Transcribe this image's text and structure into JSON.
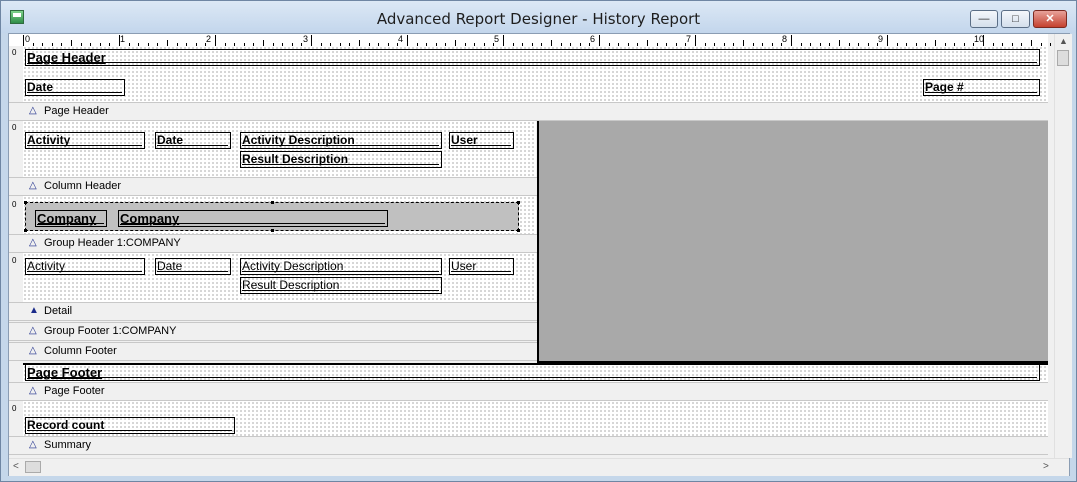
{
  "window": {
    "title": "Advanced Report Designer - History Report",
    "minimize_glyph": "—",
    "maximize_glyph": "□",
    "close_glyph": "✕"
  },
  "ruler": {
    "numbers": [
      "0",
      "1",
      "2",
      "3",
      "4",
      "5",
      "6",
      "7",
      "8",
      "9",
      "10"
    ]
  },
  "band_marker": "0",
  "bands": {
    "page_header": {
      "label": "Page Header",
      "fields": {
        "title": "Page Header",
        "date": "Date",
        "page": "Page #"
      }
    },
    "column_header": {
      "label": "Column Header",
      "fields": {
        "activity": "Activity",
        "date": "Date",
        "activity_description": "Activity Description",
        "user": "User",
        "result_description": "Result Description"
      }
    },
    "group_header": {
      "label": "Group Header 1:COMPANY",
      "fields": {
        "company_label": "Company",
        "company_value": "Company"
      }
    },
    "detail": {
      "label": "Detail",
      "fields": {
        "activity": "Activity",
        "date": "Date",
        "activity_description": "Activity Description",
        "user": "User",
        "result_description": "Result Description"
      }
    },
    "group_footer": {
      "label": "Group Footer 1:COMPANY"
    },
    "column_footer": {
      "label": "Column Footer"
    },
    "page_footer": {
      "label": "Page Footer",
      "fields": {
        "title": "Page Footer"
      }
    },
    "summary": {
      "label": "Summary",
      "fields": {
        "record_count": "Record count"
      }
    }
  },
  "icons": {
    "collapse": "△",
    "collapse_filled": "▲",
    "scroll_left": "<",
    "scroll_right": ">",
    "scroll_up": "▲",
    "scroll_down": "▼"
  },
  "colors": {
    "title_bar": "#c3d6ec",
    "close_button": "#c4412f",
    "band_label_triangle": "#1b2b8a",
    "gray_area": "#a9a9a9"
  }
}
